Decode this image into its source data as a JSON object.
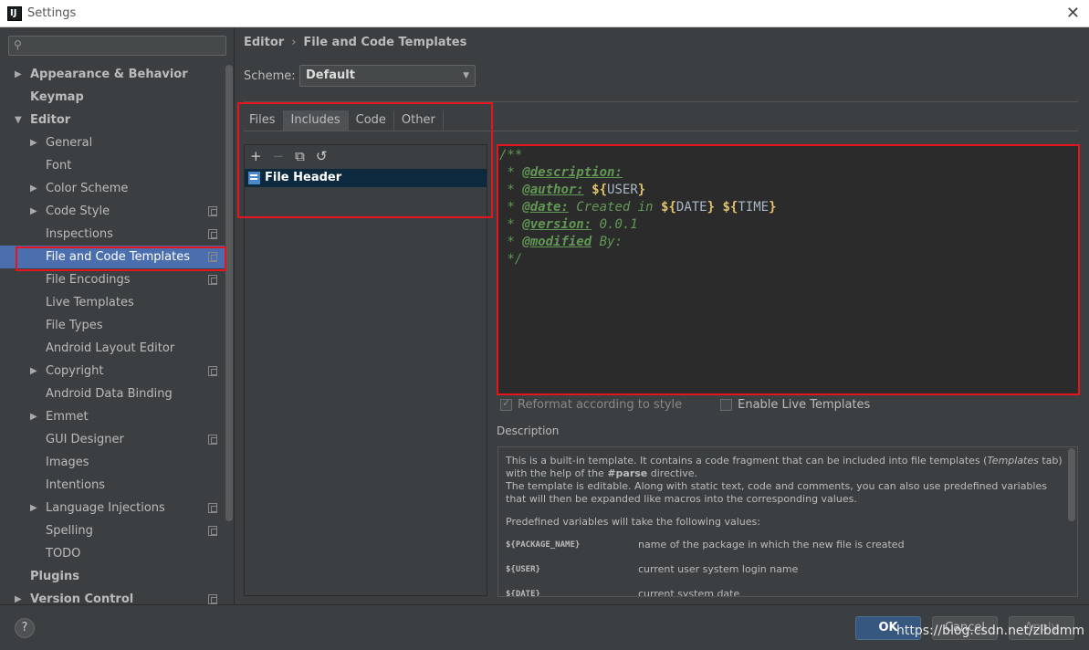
{
  "window": {
    "title": "Settings",
    "app_icon": "IJ"
  },
  "search": {
    "placeholder": ""
  },
  "sidebar": {
    "items": [
      {
        "label": "Appearance & Behavior",
        "level": 0,
        "bold": true,
        "expander": "collapsed",
        "copy_icon": false
      },
      {
        "label": "Keymap",
        "level": 0,
        "bold": true,
        "expander": "none",
        "copy_icon": false
      },
      {
        "label": "Editor",
        "level": 0,
        "bold": true,
        "expander": "expanded",
        "copy_icon": false
      },
      {
        "label": "General",
        "level": 1,
        "bold": false,
        "expander": "collapsed",
        "copy_icon": false
      },
      {
        "label": "Font",
        "level": 1,
        "bold": false,
        "expander": "none",
        "copy_icon": false
      },
      {
        "label": "Color Scheme",
        "level": 1,
        "bold": false,
        "expander": "collapsed",
        "copy_icon": false
      },
      {
        "label": "Code Style",
        "level": 1,
        "bold": false,
        "expander": "collapsed",
        "copy_icon": true
      },
      {
        "label": "Inspections",
        "level": 1,
        "bold": false,
        "expander": "none",
        "copy_icon": true
      },
      {
        "label": "File and Code Templates",
        "level": 1,
        "bold": false,
        "expander": "none",
        "copy_icon": true,
        "selected": true
      },
      {
        "label": "File Encodings",
        "level": 1,
        "bold": false,
        "expander": "none",
        "copy_icon": true
      },
      {
        "label": "Live Templates",
        "level": 1,
        "bold": false,
        "expander": "none",
        "copy_icon": false
      },
      {
        "label": "File Types",
        "level": 1,
        "bold": false,
        "expander": "none",
        "copy_icon": false
      },
      {
        "label": "Android Layout Editor",
        "level": 1,
        "bold": false,
        "expander": "none",
        "copy_icon": false
      },
      {
        "label": "Copyright",
        "level": 1,
        "bold": false,
        "expander": "collapsed",
        "copy_icon": true
      },
      {
        "label": "Android Data Binding",
        "level": 1,
        "bold": false,
        "expander": "none",
        "copy_icon": false
      },
      {
        "label": "Emmet",
        "level": 1,
        "bold": false,
        "expander": "collapsed",
        "copy_icon": false
      },
      {
        "label": "GUI Designer",
        "level": 1,
        "bold": false,
        "expander": "none",
        "copy_icon": true
      },
      {
        "label": "Images",
        "level": 1,
        "bold": false,
        "expander": "none",
        "copy_icon": false
      },
      {
        "label": "Intentions",
        "level": 1,
        "bold": false,
        "expander": "none",
        "copy_icon": false
      },
      {
        "label": "Language Injections",
        "level": 1,
        "bold": false,
        "expander": "collapsed",
        "copy_icon": true
      },
      {
        "label": "Spelling",
        "level": 1,
        "bold": false,
        "expander": "none",
        "copy_icon": true
      },
      {
        "label": "TODO",
        "level": 1,
        "bold": false,
        "expander": "none",
        "copy_icon": false
      },
      {
        "label": "Plugins",
        "level": 0,
        "bold": true,
        "expander": "none",
        "copy_icon": false
      },
      {
        "label": "Version Control",
        "level": 0,
        "bold": true,
        "expander": "collapsed",
        "copy_icon": true
      }
    ]
  },
  "breadcrumb": {
    "parent": "Editor",
    "separator": "›",
    "current": "File and Code Templates"
  },
  "scheme": {
    "label": "Scheme:",
    "value": "Default"
  },
  "tabs": [
    {
      "label": "Files",
      "active": false
    },
    {
      "label": "Includes",
      "active": true
    },
    {
      "label": "Code",
      "active": false
    },
    {
      "label": "Other",
      "active": false
    }
  ],
  "list_toolbar": {
    "add": "+",
    "remove": "−",
    "copy_icon": "copy-icon",
    "reset_icon": "reset-icon"
  },
  "templates": [
    {
      "label": "File Header",
      "selected": true
    }
  ],
  "editor": {
    "l1": "/**",
    "l2_star": " * ",
    "l2_tag": "@description:",
    "l3_star": " * ",
    "l3_tag": "@author:",
    "l3_space": " ",
    "l3_dollar": "${",
    "l3_var": "USER",
    "l3_close": "}",
    "l4_star": " * ",
    "l4_tag": "@date:",
    "l4_text": " Created in ",
    "l4_d1": "${",
    "l4_v1": "DATE",
    "l4_c1": "}",
    "l4_sp": " ",
    "l4_d2": "${",
    "l4_v2": "TIME",
    "l4_c2": "}",
    "l5_star": " * ",
    "l5_tag": "@version:",
    "l5_text": " 0.0.1",
    "l6_star": " * ",
    "l6_tag": "@modified",
    "l6_text": " By:",
    "l7": " */"
  },
  "options": {
    "reformat": {
      "label": "Reformat according to style",
      "checked": true,
      "enabled": false
    },
    "live_templates": {
      "label": "Enable Live Templates",
      "checked": false
    }
  },
  "description": {
    "label": "Description",
    "p1_a": "This is a built-in template. It contains a code fragment that can be included into file templates (",
    "p1_em": "Templates",
    "p1_b": " tab) with the help of the ",
    "p1_strong": "#parse",
    "p1_c": " directive.",
    "p2": "The template is editable. Along with static text, code and comments, you can also use predefined variables that will then be expanded like macros into the corresponding values.",
    "p3": "Predefined variables will take the following values:",
    "vars": [
      {
        "name": "${PACKAGE_NAME}",
        "desc": "name of the package in which the new file is created"
      },
      {
        "name": "${USER}",
        "desc": "current user system login name"
      },
      {
        "name": "${DATE}",
        "desc": "current system date"
      }
    ]
  },
  "buttons": {
    "help": "?",
    "ok": "OK",
    "cancel": "Cancel",
    "apply": "Apply"
  },
  "watermark": "https://blog.csdn.net/zlbdmm",
  "colors": {
    "highlight": "#e8141b",
    "selection": "#4b6eaf",
    "background": "#3c3f41",
    "editor_bg": "#2b2b2b"
  }
}
